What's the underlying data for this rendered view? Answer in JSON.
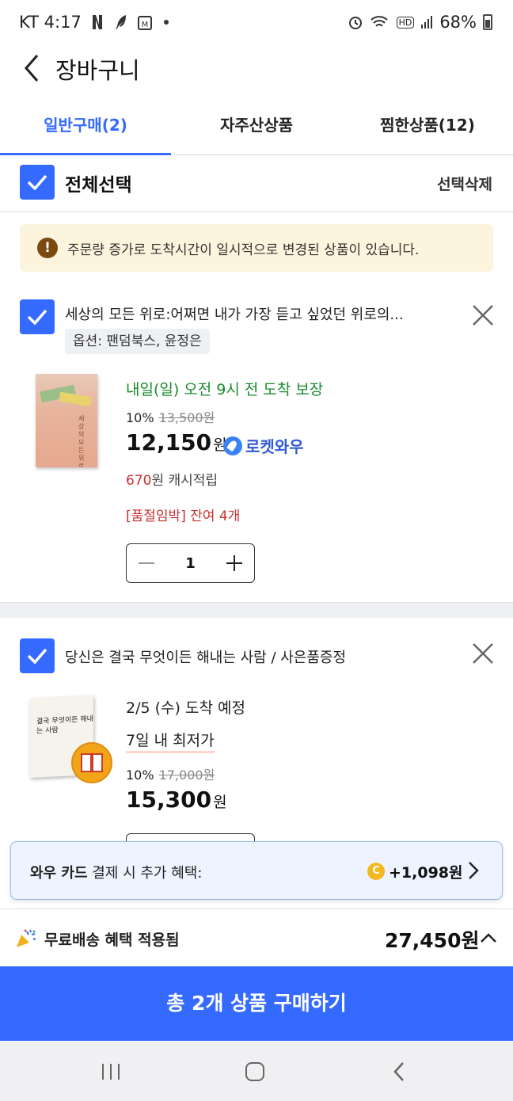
{
  "status_bar": {
    "carrier_time": "KT 4:17",
    "battery": "68%",
    "hd_label": "HD"
  },
  "header": {
    "title": "장바구니"
  },
  "tabs": [
    {
      "label": "일반구매(2)",
      "active": true
    },
    {
      "label": "자주산상품",
      "active": false
    },
    {
      "label": "찜한상품(12)",
      "active": false
    }
  ],
  "select_all": {
    "label": "전체선택",
    "delete_label": "선택삭제",
    "checked": true
  },
  "notice": {
    "icon": "!",
    "text": "주문량 증가로 도착시간이 일시적으로 변경된 상품이 있습니다."
  },
  "items": [
    {
      "checked": true,
      "title": "세상의 모든 위로:어쩌면 내가 가장 듣고 싶었던 위로의...",
      "option": "옵션: 팬덤북스, 윤정은",
      "delivery": "내일(일) 오전 9시 전 도착 보장",
      "discount": "10%",
      "original_price": "13,500원",
      "price": "12,150",
      "price_unit": "원",
      "badge": "로켓와우",
      "cashback_amount": "670",
      "cashback_label": "원 캐시적립",
      "stock_notice": "[품절임박] 잔여 4개",
      "quantity": "1",
      "cover_text": "세상의 모든 위로"
    },
    {
      "checked": true,
      "title": "당신은 결국 무엇이든 해내는 사람 / 사은품증정",
      "delivery": "2/5 (수) 도착 예정",
      "lowest_price_label": "7일 내 최저가",
      "discount": "10%",
      "original_price": "17,000원",
      "price": "15,300",
      "price_unit": "원",
      "cover_text": "결국 무엇이든 해내는 사람"
    }
  ],
  "wow_banner": {
    "brand": "와우 카드",
    "text": " 결제 시 추가 혜택:",
    "coin": "C",
    "amount": "+1,098원"
  },
  "total": {
    "free_shipping": "무료배송 혜택 적용됨",
    "amount": "27,450원"
  },
  "buy_button": "총 2개 상품 구매하기",
  "colors": {
    "accent": "#346aff",
    "delivery_green": "#1a8a2c",
    "alert_red": "#c83232",
    "notice_bg": "#fdf4dd"
  }
}
